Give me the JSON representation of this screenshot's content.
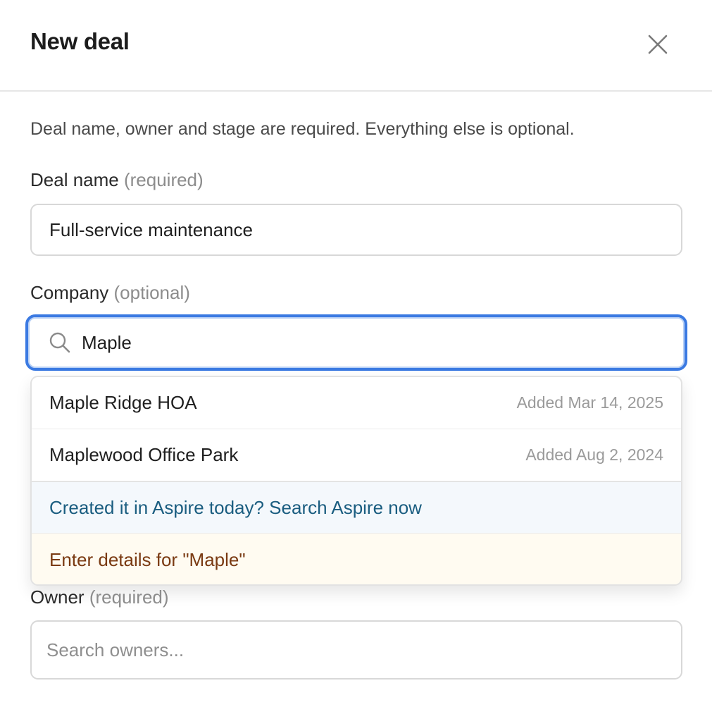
{
  "dialog": {
    "title": "New deal",
    "close_icon": "close-icon",
    "intro": "Deal name, owner and stage are required. Everything else is optional."
  },
  "fields": {
    "deal_name": {
      "label": "Deal name",
      "hint": "(required)",
      "value": "Full-service maintenance"
    },
    "company": {
      "label": "Company",
      "hint": "(optional)",
      "value": "Maple",
      "icon": "search-icon"
    },
    "owner": {
      "label": "Owner",
      "hint": "(required)",
      "placeholder": "Search owners..."
    }
  },
  "company_dropdown": {
    "options": [
      {
        "name": "Maple Ridge HOA",
        "added": "Added Mar 14, 2025"
      },
      {
        "name": "Maplewood Office Park",
        "added": "Added Aug 2, 2024"
      }
    ],
    "aspire_action": "Created it in Aspire today? Search Aspire now",
    "enter_details": "Enter details for \"Maple\""
  },
  "colors": {
    "focus_border": "#3b7ae2",
    "aspire_text": "#1a5d80",
    "aspire_bg": "#f4f8fc",
    "enter_text": "#7a3a12",
    "enter_bg": "#fffbf1"
  }
}
